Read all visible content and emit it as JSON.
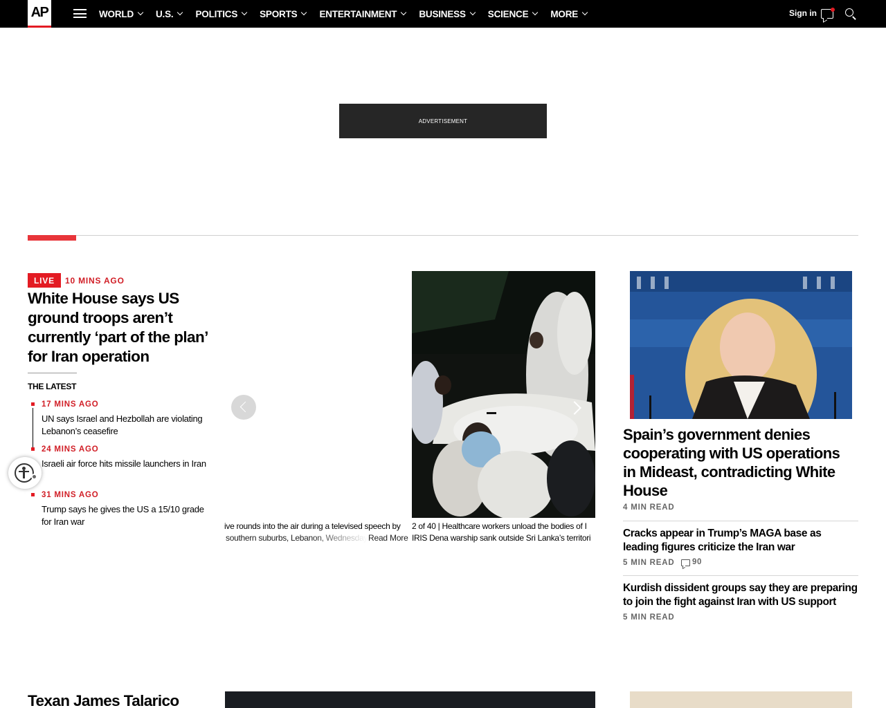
{
  "brand": {
    "logo_text": "AP",
    "accent": "#e31b23"
  },
  "nav": {
    "items": [
      {
        "label": "WORLD"
      },
      {
        "label": "U.S."
      },
      {
        "label": "POLITICS"
      },
      {
        "label": "SPORTS"
      },
      {
        "label": "ENTERTAINMENT"
      },
      {
        "label": "BUSINESS"
      },
      {
        "label": "SCIENCE"
      },
      {
        "label": "MORE"
      }
    ],
    "sign_in": "Sign in",
    "icons": [
      "menu-icon",
      "chevron-down-icon",
      "chat-icon",
      "search-icon"
    ]
  },
  "ad": {
    "label": "ADVERTISEMENT"
  },
  "lead": {
    "badge": "LIVE",
    "time": "10 MINS AGO",
    "headline": "White House says US ground troops aren’t currently ‘part of the plan’ for Iran operation",
    "latest_label": "THE LATEST",
    "timeline": [
      {
        "time": "17 MINS AGO",
        "text": "UN says Israel and Hezbollah are violating Lebanon’s ceasefire"
      },
      {
        "time": "24 MINS AGO",
        "text": "Israeli air force hits missile launchers in Iran"
      },
      {
        "time": "31 MINS AGO",
        "text": "Trump says he gives the US a 15/10 grade for Iran war"
      }
    ]
  },
  "carousel": {
    "prev_caption_line1": "ive rounds into the air during a televised speech by",
    "prev_caption_line2": "southern suburbs, Lebanon, Wednesday",
    "read_more": "Read More",
    "current_caption_line1": "2 of 40 |  Healthcare workers unload the bodies of I",
    "current_caption_line2": "IRIS Dena warship sank outside Sri Lanka’s territori"
  },
  "right": {
    "headline": "Spain’s government denies cooperating with US operations in Mideast, contradicting White House",
    "read_time": "4 MIN READ",
    "stories": [
      {
        "headline": "Cracks appear in Trump’s MAGA base as leading figures criticize the Iran war",
        "read_time": "5 MIN READ",
        "comments": "90"
      },
      {
        "headline": "Kurdish dissident groups say they are preparing to join the fight against Iran with US support",
        "read_time": "5 MIN READ"
      }
    ]
  },
  "bottom": {
    "headline": "Texan James Talarico"
  }
}
